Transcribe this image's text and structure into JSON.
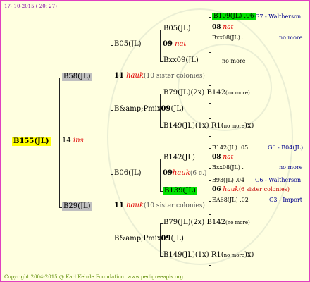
{
  "header": {
    "date": "17- 10-2015 ( 20: 27)"
  },
  "footer": {
    "copyright": "Copyright 2004-2015 @ Karl Kehrle Foundation.   www.pedigreeapis.org"
  },
  "root": {
    "id": "B155(JL)",
    "year": "14",
    "breed": "ins"
  },
  "gen1": {
    "upper": {
      "id": "B58(JL)",
      "year": "11",
      "breed": "hauk",
      "note": "(10 sister colonies)"
    },
    "lower": {
      "id": "B29(JL)",
      "year": "11",
      "breed": "hauk",
      "note": "(10 sister colonies)"
    }
  },
  "gen2": {
    "u1": {
      "id": "B05(JL)",
      "year": "09",
      "breed": "nat"
    },
    "u2": {
      "id": "B&amp;Pmix",
      "year": "09",
      "suffix": "(JL)"
    },
    "l1": {
      "id": "B06(JL)",
      "year": "09",
      "breed": "hauk",
      "note": "(6 c.)"
    },
    "l2": {
      "id": "B&amp;Pmix",
      "year": "09",
      "suffix": "(JL)"
    }
  },
  "gen3": {
    "a": {
      "id": "B05(JL)"
    },
    "b": {
      "id": "Bxx09(JL)"
    },
    "c": {
      "id": "B79(JL)(2x) B142",
      "tag": "no more"
    },
    "d": {
      "id": "B149(JL)(1x) R1(",
      "tag": "no more",
      "end": ")x)"
    },
    "e": {
      "id": "B142(JL)"
    },
    "f": {
      "id": "B139(JL)"
    },
    "g": {
      "id": "B79(JL)(2x) B142",
      "tag": "no more"
    },
    "h": {
      "id": "B149(JL)(1x) R1(",
      "tag": "no more",
      "end": ")x)"
    }
  },
  "gen4": {
    "a1": {
      "id": "B109(JL) .06",
      "source": "G7 - Waltherson"
    },
    "a2": {
      "year": "08",
      "breed": "nat"
    },
    "a3": {
      "id": "Bxx08(JL) .",
      "source": "no more"
    },
    "b1": {
      "source": "no more"
    },
    "e1": {
      "id": "B142(JL) .05",
      "source": "G6 - B04(JL)"
    },
    "e2": {
      "year": "08",
      "breed": "nat"
    },
    "e3": {
      "id": "Bxx08(JL) .",
      "source": "no more"
    },
    "f1": {
      "id": "B93(JL) .04",
      "source": "G6 - Waltherson"
    },
    "f2": {
      "year": "06",
      "breed": "hauk",
      "note": "(6 sister colonies)"
    },
    "f3": {
      "id": "EA68(JL) .02",
      "source": "G3 - Import"
    }
  }
}
